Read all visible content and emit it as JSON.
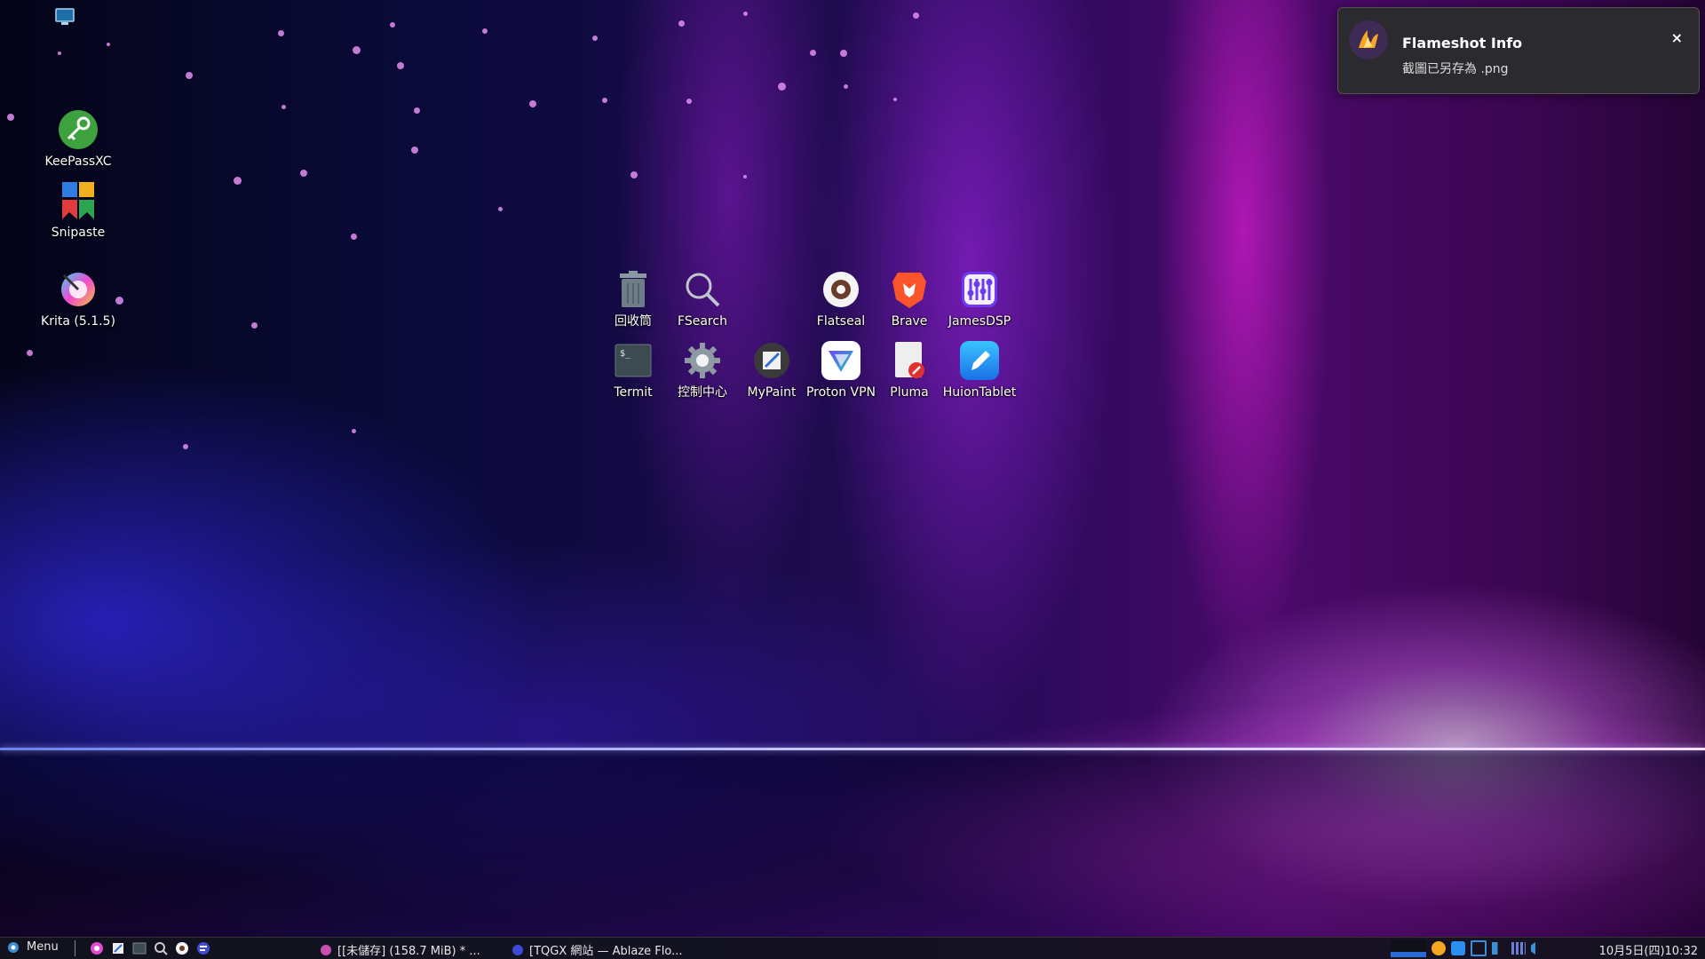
{
  "desktop": {
    "left_icons": [
      {
        "label": "KeePassXC",
        "icon": "keepassxc-icon"
      },
      {
        "label": "Snipaste",
        "icon": "snipaste-icon"
      },
      {
        "label": "Krita (5.1.5)",
        "icon": "krita-icon"
      }
    ],
    "grid_icons": [
      {
        "label": "回收筒",
        "icon": "trash-icon"
      },
      {
        "label": "FSearch",
        "icon": "fsearch-icon"
      },
      {
        "label": "Flatseal",
        "icon": "flatseal-icon"
      },
      {
        "label": "Brave",
        "icon": "brave-icon"
      },
      {
        "label": "JamesDSP",
        "icon": "jamesdsp-icon"
      },
      {
        "label": "Termit",
        "icon": "terminal-icon"
      },
      {
        "label": "控制中心",
        "icon": "control-center-icon"
      },
      {
        "label": "MyPaint",
        "icon": "mypaint-icon"
      },
      {
        "label": "Proton VPN",
        "icon": "protonvpn-icon"
      },
      {
        "label": "Pluma",
        "icon": "pluma-icon"
      },
      {
        "label": "HuionTablet",
        "icon": "huiontablet-icon"
      }
    ]
  },
  "notification": {
    "title": "Flameshot Info",
    "body": "截圖已另存為 .png",
    "close": "×"
  },
  "taskbar": {
    "menu_label": "Menu",
    "tasks": [
      {
        "label": "[[未儲存] (158.7 MiB) * ..."
      },
      {
        "label": "[TQGX 網站 — Ablaze Flo..."
      }
    ],
    "clock": "10月5日(四)10:32"
  },
  "colors": {
    "notification_bg": "#2b2a2e",
    "taskbar_bg": "#14141e",
    "accent_pink": "#e38ef0"
  }
}
